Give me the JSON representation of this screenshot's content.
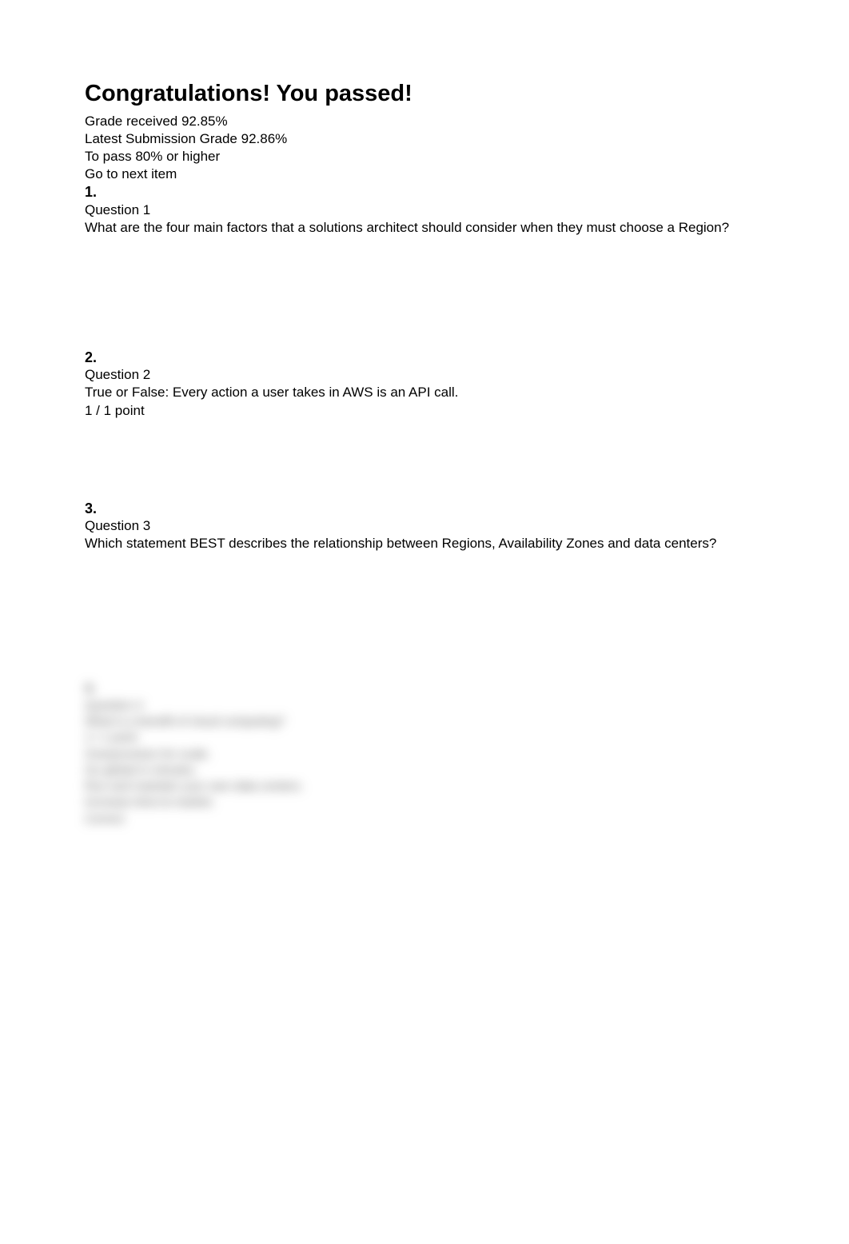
{
  "header": {
    "title": "Congratulations! You passed!",
    "grade_received_label": "Grade received",
    "grade_received_value": "92.85%",
    "latest_grade_label": "Latest Submission Grade",
    "latest_grade_value": "92.86%",
    "to_pass_label": "To pass",
    "to_pass_value": "80% or higher",
    "go_next": "Go to next item"
  },
  "questions": [
    {
      "number": "1.",
      "label": "Question 1",
      "text": "What are the four main factors that a solutions architect should consider when they must choose a Region?",
      "points": ""
    },
    {
      "number": "2.",
      "label": "Question 2",
      "text": "True or False: Every action a user takes in AWS is an API call.",
      "points": "1 / 1 point"
    },
    {
      "number": "3.",
      "label": "Question 3",
      "text": "Which statement BEST describes the relationship between Regions, Availability Zones and data centers?",
      "points": ""
    }
  ],
  "blurred": {
    "number": "4.",
    "label": "Question 4",
    "line1": "What is a benefit of cloud computing?",
    "line2": "1 / 1 point",
    "line3": "Overprovision for scale.",
    "line4": "Go global in minutes.",
    "line5": "Run and maintain your own data centers.",
    "line6": "Increase time-to-market.",
    "line7": "Correct"
  }
}
